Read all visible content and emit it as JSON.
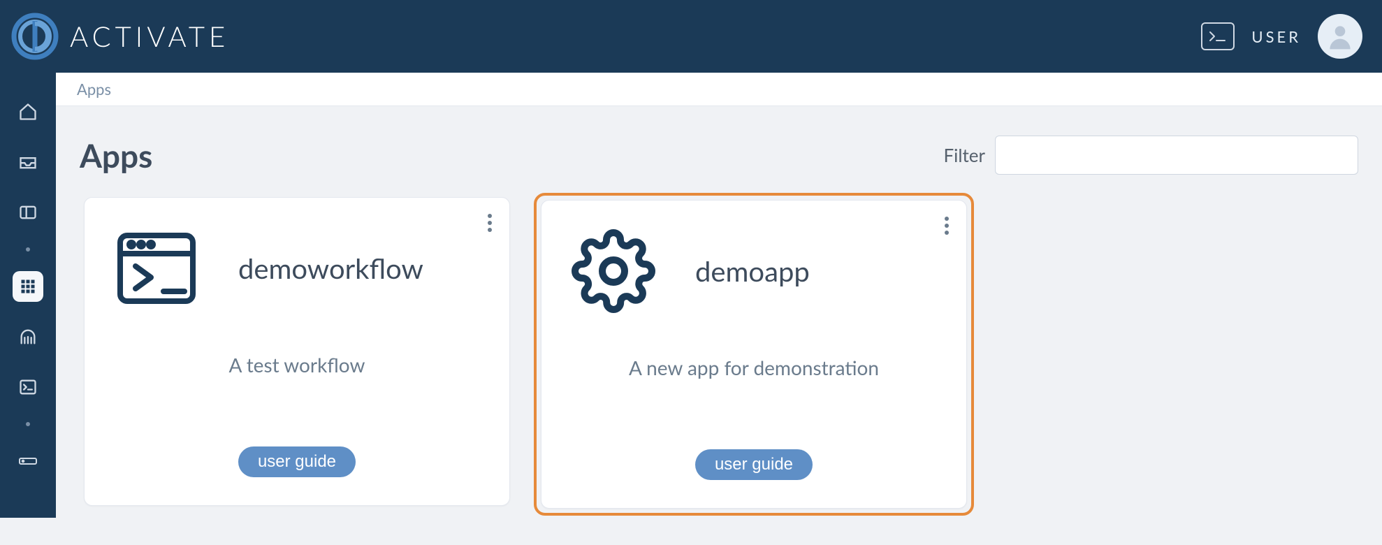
{
  "header": {
    "brand": "ACTIVATE",
    "user_label": "USER"
  },
  "breadcrumb": "Apps",
  "page_title": "Apps",
  "filter": {
    "label": "Filter",
    "value": ""
  },
  "cards": [
    {
      "title": "demoworkflow",
      "description": "A test workflow",
      "button": "user guide",
      "icon": "terminal-window-icon",
      "highlight": false
    },
    {
      "title": "demoapp",
      "description": "A new app for demonstration",
      "button": "user guide",
      "icon": "gear-icon",
      "highlight": true
    }
  ]
}
